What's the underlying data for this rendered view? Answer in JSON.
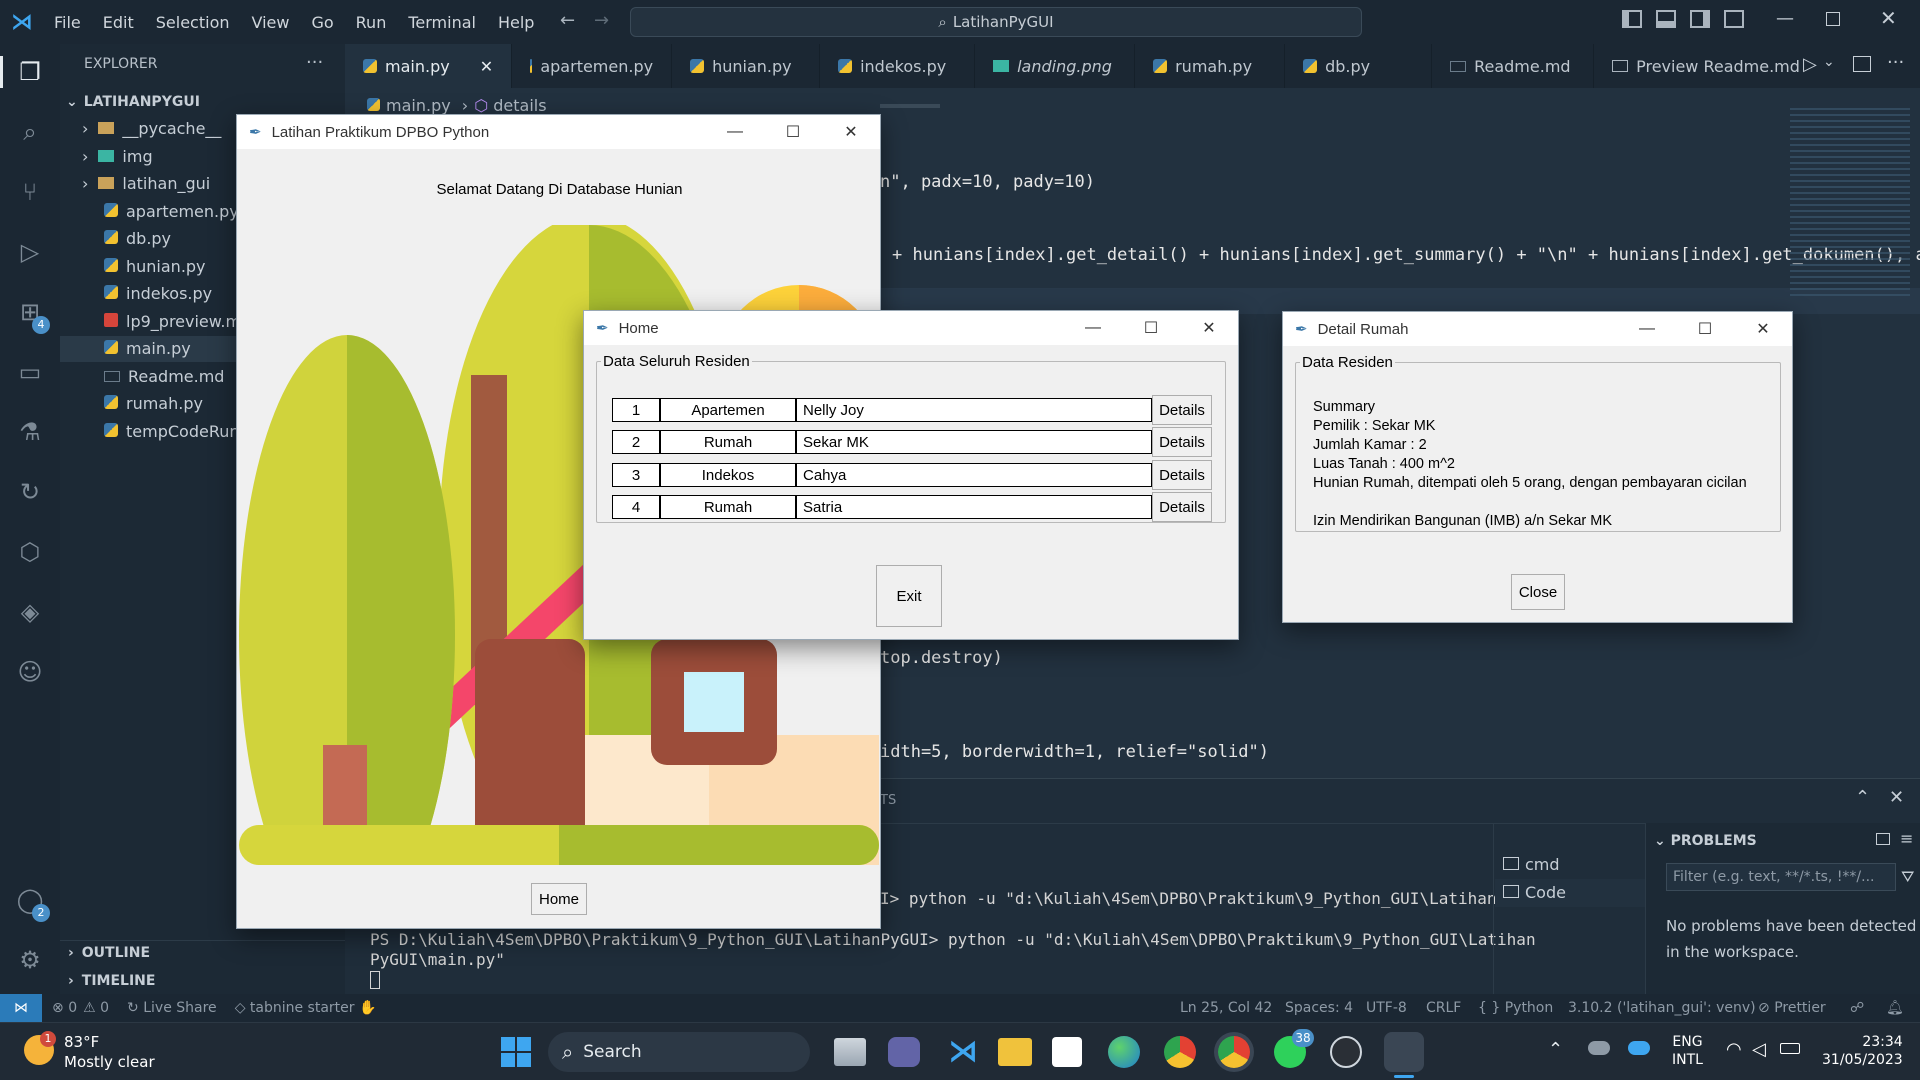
{
  "menu": [
    "File",
    "Edit",
    "Selection",
    "View",
    "Go",
    "Run",
    "Terminal",
    "Help"
  ],
  "search_title": "LatihanPyGUI",
  "explorer": {
    "header": "EXPLORER",
    "root": "LATIHANPYGUI",
    "items": [
      "__pycache__",
      "img",
      "latihan_gui",
      "apartemen.py",
      "db.py",
      "hunian.py",
      "indekos.py",
      "lp9_preview.mp",
      "main.py",
      "Readme.md",
      "rumah.py",
      "tempCodeRun"
    ],
    "outline": "OUTLINE",
    "timeline": "TIMELINE"
  },
  "tabs": [
    "main.py",
    "apartemen.py",
    "hunian.py",
    "indekos.py",
    "landing.png",
    "rumah.py",
    "db.py",
    "Readme.md",
    "Preview Readme.md"
  ],
  "breadcrumb": {
    "file": "main.py",
    "symbol": "details"
  },
  "code": {
    "l1": "n\", padx=10, pady=10)",
    "l2": "+ hunians[index].get_detail() + hunians[index].get_summary() + \"\\n\" + hunians[index].get_dokumen(), ancho",
    "l3": "top.destroy)",
    "l4": "idth=5, borderwidth=1, relief=\"solid\")"
  },
  "panel": {
    "tab_fragment": "TS",
    "term1": "I> python -u \"d:\\Kuliah\\4Sem\\DPBO\\Praktikum\\9_Python_GUI\\Latihan",
    "term2a": "PS D:\\Kuliah\\4Sem\\DPBO\\Praktikum\\9_Python_GUI\\LatihanPyGUI> python -u \"d:\\Kuliah\\4Sem\\DPBO\\Praktikum\\9_Python_GUI\\Latihan",
    "term2b": "PyGUI\\main.py\"",
    "terminals": [
      "cmd",
      "Code"
    ],
    "problems_title": "PROBLEMS",
    "filter_placeholder": "Filter (e.g. text, **/*.ts, !**/...",
    "problems_msg1": "No problems have been detected",
    "problems_msg2": "in the workspace."
  },
  "status": {
    "errors": "0",
    "warnings": "0",
    "live_share": "Live Share",
    "tabnine": "tabnine starter",
    "position": "Ln 25, Col 42",
    "spaces": "Spaces: 4",
    "encoding": "UTF-8",
    "eol": "CRLF",
    "language": "Python",
    "interpreter": "3.10.2 ('latihan_gui': venv)",
    "prettier": "Prettier"
  },
  "main_window": {
    "title": "Latihan Praktikum DPBO Python",
    "welcome": "Selamat Datang Di Database Hunian",
    "home_button": "Home"
  },
  "home_window": {
    "title": "Home",
    "frame_label": "Data Seluruh Residen",
    "rows": [
      {
        "no": "1",
        "type": "Apartemen",
        "name": "Nelly Joy"
      },
      {
        "no": "2",
        "type": "Rumah",
        "name": "Sekar MK"
      },
      {
        "no": "3",
        "type": "Indekos",
        "name": "Cahya"
      },
      {
        "no": "4",
        "type": "Rumah",
        "name": "Satria"
      }
    ],
    "details_label": "Details",
    "exit_label": "Exit"
  },
  "detail_window": {
    "title": "Detail Rumah",
    "frame_label": "Data Residen",
    "lines": [
      "Summary",
      "Pemilik : Sekar MK",
      "Jumlah Kamar : 2",
      "Luas Tanah : 400 m^2",
      "Hunian Rumah, ditempati oleh 5 orang, dengan pembayaran cicilan",
      "",
      "Izin Mendirikan Bangunan (IMB) a/n Sekar MK"
    ],
    "close_label": "Close"
  },
  "taskbar": {
    "weather_temp": "83°F",
    "weather_desc": "Mostly clear",
    "weather_badge": "1",
    "search": "Search",
    "whatsapp_badge": "38",
    "lang1": "ENG",
    "lang2": "INTL",
    "time": "23:34",
    "date": "31/05/2023"
  },
  "badges": {
    "extensions": "4",
    "accounts": "2"
  },
  "colors": {
    "accent": "#0078d4",
    "sidebar_bg": "#1c2935",
    "editor_bg": "#22313f"
  }
}
